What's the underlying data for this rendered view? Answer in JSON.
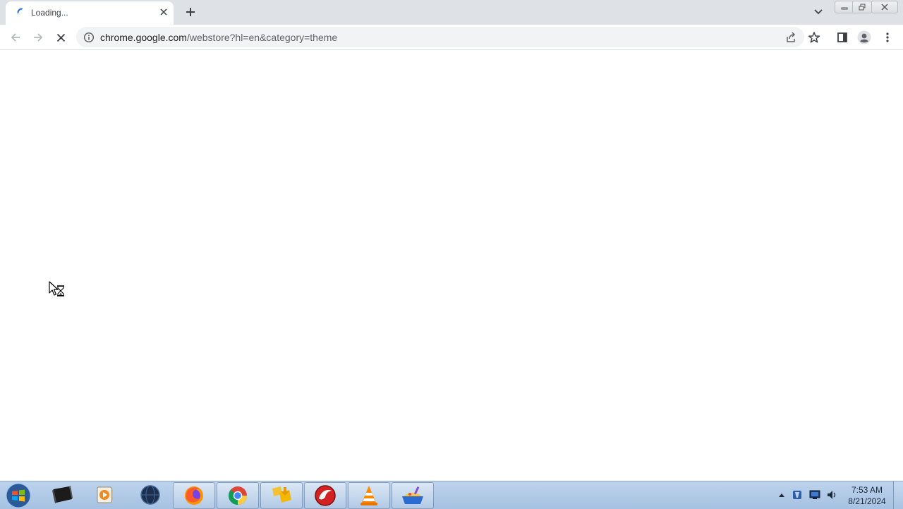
{
  "browser": {
    "tab": {
      "title": "Loading...",
      "close_symbol": "×"
    },
    "new_tab_symbol": "+",
    "address_bar": {
      "host": "chrome.google.com",
      "path": "/webstore?hl=en&category=theme"
    }
  },
  "taskbar": {
    "apps": [
      "start-orb-icon",
      "terminal-icon",
      "media-player-icon",
      "dark-globe-icon",
      "firefox-icon",
      "chrome-icon",
      "file-manager-icon",
      "red-app-icon",
      "vlc-icon",
      "paint-app-icon"
    ],
    "clock": {
      "time": "7:53 AM",
      "date": "8/21/2024"
    }
  },
  "colors": {
    "tabstrip": "#dee1e6",
    "omnibox": "#f1f3f4",
    "taskbar": "#a6c1e2"
  }
}
